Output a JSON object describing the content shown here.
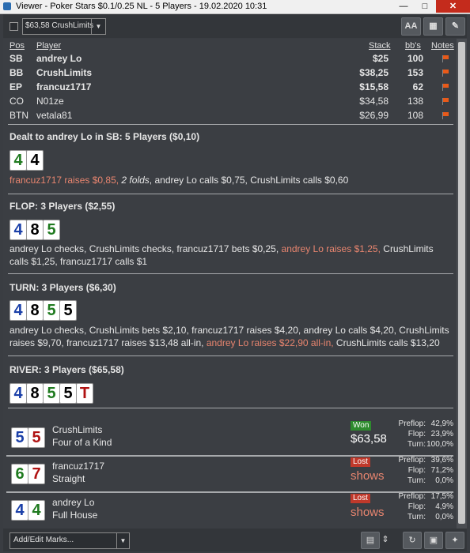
{
  "window": {
    "title": "Viewer - Poker Stars $0.1/0.25 NL - 5 Players - 19.02.2020 10:31",
    "min_icon": "minimize-icon",
    "max_icon": "maximize-icon",
    "close_icon": "close-icon"
  },
  "toolbar": {
    "player_select_value": "$63,58 CrushLimits",
    "font_btn": "AA",
    "icons": [
      "font-size-icon",
      "grid-icon",
      "pencil-icon"
    ]
  },
  "players_table": {
    "headers": {
      "pos": "Pos",
      "player": "Player",
      "stack": "Stack",
      "bbs": "bb's",
      "notes": "Notes"
    },
    "rows": [
      {
        "pos": "SB",
        "player": "andrey Lo",
        "stack": "$25",
        "bbs": "100",
        "bold": true
      },
      {
        "pos": "BB",
        "player": "CrushLimits",
        "stack": "$38,25",
        "bbs": "153",
        "bold": true
      },
      {
        "pos": "EP",
        "player": "francuz1717",
        "stack": "$15,58",
        "bbs": "62",
        "bold": true
      },
      {
        "pos": "CO",
        "player": "N01ze",
        "stack": "$34,58",
        "bbs": "138",
        "bold": false
      },
      {
        "pos": "BTN",
        "player": "vetala81",
        "stack": "$26,99",
        "bbs": "108",
        "bold": false
      }
    ]
  },
  "preflop": {
    "title": "Dealt to andrey Lo in SB: 5 Players ($0,10)",
    "cards": [
      {
        "rank": "4",
        "suit": "g"
      },
      {
        "rank": "4",
        "suit": "k"
      }
    ],
    "action_parts": [
      "francuz1717 raises $0,85,",
      " 2 folds",
      ", andrey Lo calls $0,75, CrushLimits calls $0,60"
    ]
  },
  "flop": {
    "title": "FLOP: 3 Players ($2,55)",
    "cards": [
      {
        "rank": "4",
        "suit": "b"
      },
      {
        "rank": "8",
        "suit": "k"
      },
      {
        "rank": "5",
        "suit": "g"
      }
    ],
    "action_parts": [
      "andrey Lo checks, CrushLimits checks, francuz1717 bets $0,25, ",
      "andrey Lo raises $1,25,",
      " CrushLimits calls $1,25, francuz1717 calls $1"
    ]
  },
  "turn": {
    "title": "TURN: 3 Players ($6,30)",
    "cards": [
      {
        "rank": "4",
        "suit": "b"
      },
      {
        "rank": "8",
        "suit": "k"
      },
      {
        "rank": "5",
        "suit": "g"
      },
      {
        "rank": "5",
        "suit": "k"
      }
    ],
    "action_parts": [
      "andrey Lo checks, CrushLimits bets $2,10, francuz1717 raises $4,20, andrey Lo calls $4,20, CrushLimits raises $9,70, francuz1717 raises $13,48 all-in, ",
      "andrey Lo raises $22,90 all-in,",
      " CrushLimits calls $13,20"
    ]
  },
  "river": {
    "title": "RIVER: 3 Players ($65,58)",
    "cards": [
      {
        "rank": "4",
        "suit": "b"
      },
      {
        "rank": "8",
        "suit": "k"
      },
      {
        "rank": "5",
        "suit": "g"
      },
      {
        "rank": "5",
        "suit": "k"
      },
      {
        "rank": "T",
        "suit": "r"
      }
    ]
  },
  "results": [
    {
      "cards": [
        {
          "rank": "5",
          "suit": "b"
        },
        {
          "rank": "5",
          "suit": "r"
        }
      ],
      "player": "CrushLimits",
      "hand": "Four of a Kind",
      "status": "Won",
      "won": true,
      "amount": "$63,58",
      "stats": [
        {
          "label": "Preflop:",
          "value": "42,9%"
        },
        {
          "label": "Flop:",
          "value": "23,9%"
        },
        {
          "label": "Turn:",
          "value": "100,0%"
        }
      ]
    },
    {
      "cards": [
        {
          "rank": "6",
          "suit": "g"
        },
        {
          "rank": "7",
          "suit": "r"
        }
      ],
      "player": "francuz1717",
      "hand": "Straight",
      "status": "Lost",
      "won": false,
      "amount": "shows",
      "stats": [
        {
          "label": "Preflop:",
          "value": "39,6%"
        },
        {
          "label": "Flop:",
          "value": "71,2%"
        },
        {
          "label": "Turn:",
          "value": "0,0%"
        }
      ]
    },
    {
      "cards": [
        {
          "rank": "4",
          "suit": "b"
        },
        {
          "rank": "4",
          "suit": "g"
        }
      ],
      "player": "andrey Lo",
      "hand": "Full House",
      "status": "Lost",
      "won": false,
      "amount": "shows",
      "stats": [
        {
          "label": "Preflop:",
          "value": "17,5%"
        },
        {
          "label": "Flop:",
          "value": "4,9%"
        },
        {
          "label": "Turn:",
          "value": "0,0%"
        }
      ]
    }
  ],
  "bottom": {
    "marks_select": "Add/Edit Marks...",
    "icons": [
      "calendar-icon",
      "stepper-icon",
      "refresh-icon",
      "save-icon",
      "twitter-icon"
    ]
  },
  "colors": {
    "background": "#3b3e43",
    "highlight": "#e8856f",
    "won": "#2e8b2e",
    "lost": "#c0392b",
    "flag": "#e85a1a"
  }
}
